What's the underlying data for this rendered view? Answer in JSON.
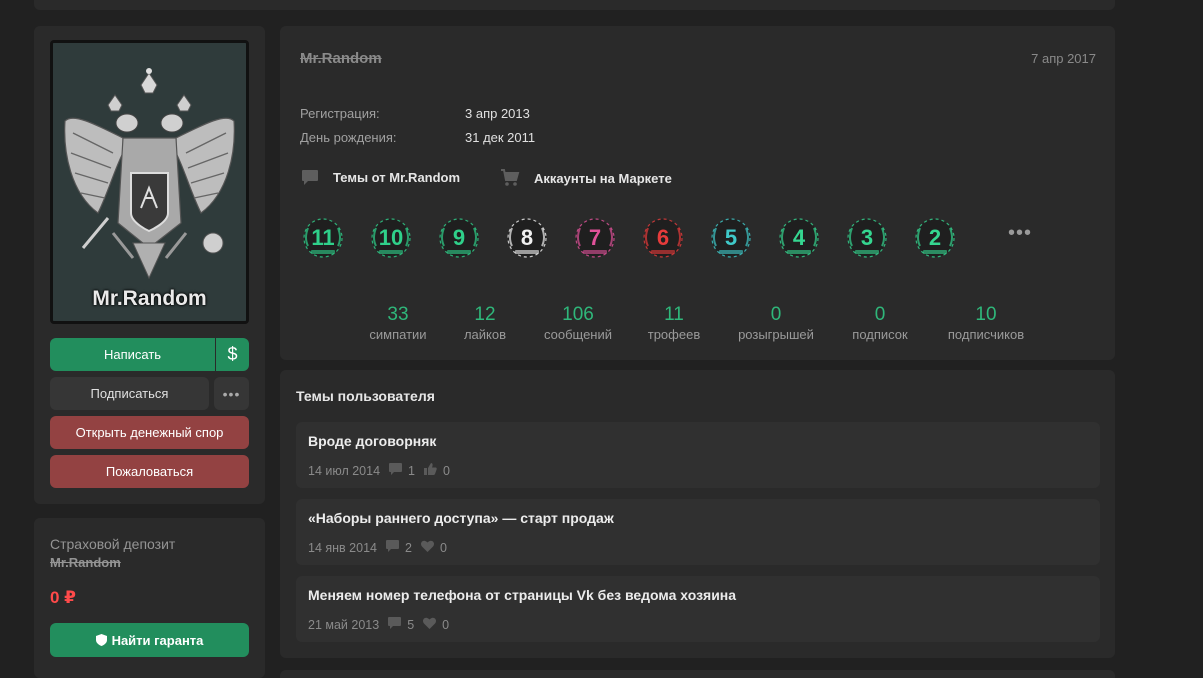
{
  "user": {
    "avatar_text": "Mr.Random",
    "name": "Mr.Random",
    "profile_date": "7 апр 2017"
  },
  "actions": {
    "write": "Написать",
    "dollar": "$",
    "subscribe": "Подписаться",
    "more": "•••",
    "dispute": "Открыть денежный спор",
    "report": "Пожаловаться"
  },
  "deposit": {
    "title": "Страховой депозит",
    "user": "Mr.Random",
    "amount": "0 ₽",
    "find_guarant": "Найти гаранта"
  },
  "info": {
    "registration_label": "Регистрация:",
    "registration_value": "3 апр 2013",
    "birthday_label": "День рождения:",
    "birthday_value": "31 дек 2011"
  },
  "links": {
    "topics_from": "Темы от Mr.Random",
    "market_accounts": "Аккаунты на Маркете"
  },
  "trophies": {
    "items": [
      {
        "icon": "trophy-11-icon",
        "number": "11",
        "color": "#2fd08a"
      },
      {
        "icon": "trophy-10-icon",
        "number": "10",
        "color": "#2fd08a"
      },
      {
        "icon": "trophy-9-icon",
        "number": "9",
        "color": "#2fd08a"
      },
      {
        "icon": "trophy-8-icon",
        "number": "8",
        "color": "#f0f0f0"
      },
      {
        "icon": "trophy-7-icon",
        "number": "7",
        "color": "#e0529a"
      },
      {
        "icon": "trophy-6-icon",
        "number": "6",
        "color": "#e63b3b"
      },
      {
        "icon": "trophy-5-icon",
        "number": "5",
        "color": "#3fc9c9"
      },
      {
        "icon": "trophy-4-icon",
        "number": "4",
        "color": "#35d690"
      },
      {
        "icon": "trophy-3-icon",
        "number": "3",
        "color": "#35d690"
      },
      {
        "icon": "trophy-2-icon",
        "number": "2",
        "color": "#35d690"
      }
    ],
    "more": "•••"
  },
  "stats": [
    {
      "value": "33",
      "label": "симпатии"
    },
    {
      "value": "12",
      "label": "лайков"
    },
    {
      "value": "106",
      "label": "сообщений"
    },
    {
      "value": "11",
      "label": "трофеев"
    },
    {
      "value": "0",
      "label": "розыгрышей"
    },
    {
      "value": "0",
      "label": "подписок"
    },
    {
      "value": "10",
      "label": "подписчиков"
    }
  ],
  "topics": {
    "title": "Темы пользователя",
    "items": [
      {
        "title": "Вроде договорняк",
        "date": "14 июл 2014",
        "replies": "1",
        "likes": "0",
        "like_icon": "thumbs-up-icon"
      },
      {
        "title": "«Наборы раннего доступа» — старт продаж",
        "date": "14 янв 2014",
        "replies": "2",
        "likes": "0",
        "like_icon": "heart-icon"
      },
      {
        "title": "Меняем номер телефона от страницы Vk без ведома хозяина",
        "date": "21 май 2013",
        "replies": "5",
        "likes": "0",
        "like_icon": "heart-icon"
      }
    ]
  },
  "colors": {
    "accent_green": "#228e5d",
    "stat_green": "#2fb77a",
    "danger_red": "#934242",
    "amount_red": "#ff4a4a"
  }
}
